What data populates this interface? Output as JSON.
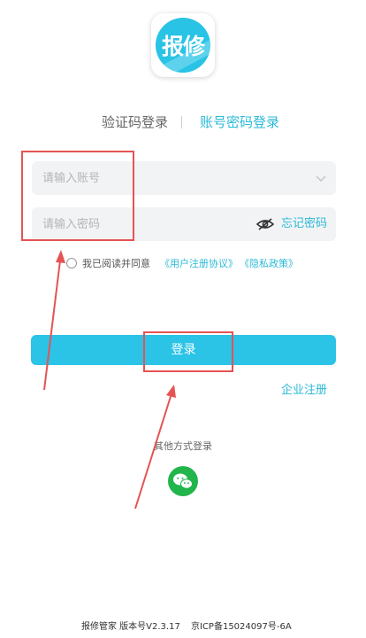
{
  "logo": {
    "text": "报修"
  },
  "tabs": {
    "sms_login": "验证码登录",
    "password_login": "账号密码登录"
  },
  "account": {
    "placeholder": "请输入账号"
  },
  "password": {
    "placeholder": "请输入密码",
    "forgot": "忘记密码"
  },
  "agreement": {
    "prefix": "我已阅读并同意",
    "terms": "《用户注册协议》",
    "privacy": "《隐私政策》"
  },
  "login_button": {
    "label": "登录"
  },
  "enterprise_register": "企业注册",
  "other_login": "其他方式登录",
  "footer": {
    "app_version": "报修管家 版本号V2.3.17",
    "icp": "京ICP备15024097号-6A"
  },
  "colors": {
    "accent": "#2bc3e6",
    "link": "#2bbad7",
    "wechat": "#22b54c",
    "annotation": "#e55353"
  }
}
